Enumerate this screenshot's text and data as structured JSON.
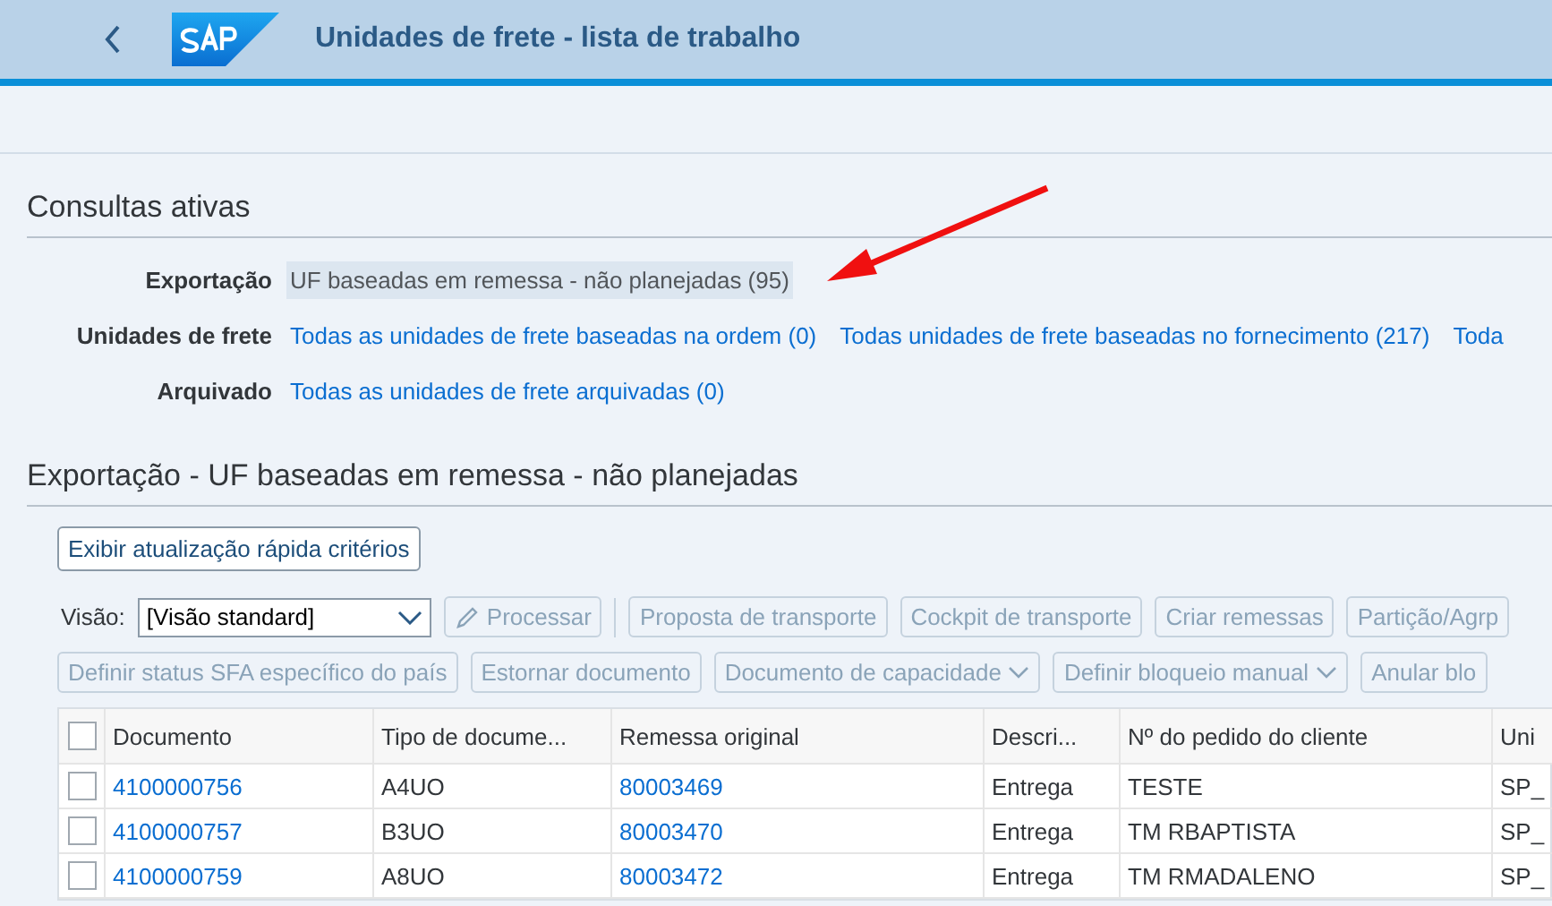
{
  "shell": {
    "title": "Unidades de frete - lista de trabalho"
  },
  "queries": {
    "title": "Consultas ativas",
    "rows": [
      {
        "label": "Exportação",
        "links": [
          {
            "text": "UF baseadas em remessa - não planejadas (95)",
            "selected": true
          }
        ]
      },
      {
        "label": "Unidades de frete",
        "links": [
          {
            "text": "Todas as unidades de frete baseadas na ordem (0)",
            "selected": false
          },
          {
            "text": "Todas unidades de frete baseadas no fornecimento (217)",
            "selected": false
          },
          {
            "text": "Toda",
            "selected": false
          }
        ]
      },
      {
        "label": "Arquivado",
        "links": [
          {
            "text": "Todas as unidades de frete arquivadas (0)",
            "selected": false
          }
        ]
      }
    ]
  },
  "list": {
    "title": "Exportação - UF baseadas em remessa - não planejadas",
    "criteria_button": "Exibir atualização rápida critérios",
    "view_label": "Visão:",
    "view_value": "[Visão standard]",
    "toolbar_rows": [
      [
        {
          "label": "Processar",
          "kind": "edit",
          "separator_after": true
        },
        {
          "label": "Proposta de transporte",
          "kind": "plain",
          "separator_after": false
        },
        {
          "label": "Cockpit de transporte",
          "kind": "plain",
          "separator_after": false
        },
        {
          "label": "Criar remessas",
          "kind": "plain",
          "separator_after": false
        },
        {
          "label": "Partição/Agrp",
          "kind": "plain",
          "separator_after": false
        }
      ],
      [
        {
          "label": "Definir status SFA específico do país",
          "kind": "plain",
          "separator_after": false
        },
        {
          "label": "Estornar documento",
          "kind": "plain",
          "separator_after": false
        },
        {
          "label": "Documento de capacidade",
          "kind": "menu",
          "separator_after": false
        },
        {
          "label": "Definir bloqueio manual",
          "kind": "menu",
          "separator_after": false
        },
        {
          "label": "Anular blo",
          "kind": "plain",
          "separator_after": false
        }
      ]
    ],
    "all_checked": false,
    "columns": [
      "Documento",
      "Tipo de docume...",
      "Remessa original",
      "Descri...",
      "Nº do pedido do cliente",
      "Uni"
    ],
    "rows": [
      {
        "checked": false,
        "cells": [
          "4100000756",
          "A4UO",
          "80003469",
          "Entrega",
          "TESTE",
          "SP_"
        ]
      },
      {
        "checked": false,
        "cells": [
          "4100000757",
          "B3UO",
          "80003470",
          "Entrega",
          "TM RBAPTISTA",
          "SP_"
        ]
      },
      {
        "checked": false,
        "cells": [
          "4100000759",
          "A8UO",
          "80003472",
          "Entrega",
          "TM RMADALENO",
          "SP_"
        ]
      }
    ]
  }
}
